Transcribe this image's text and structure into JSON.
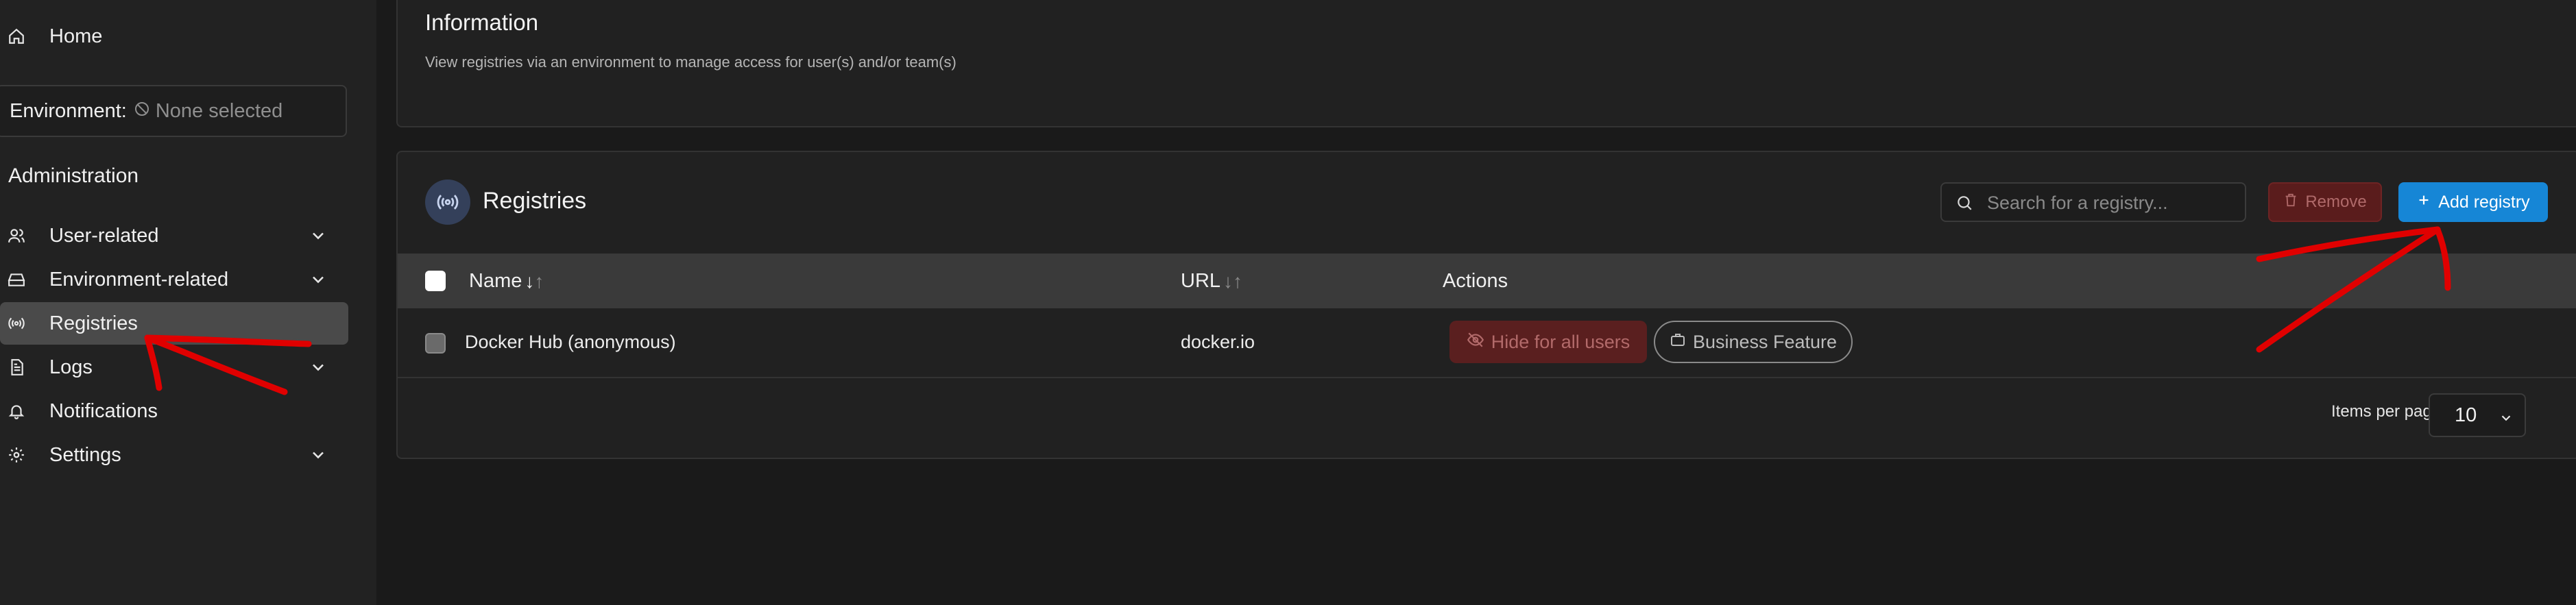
{
  "sidebar": {
    "home_label": "Home",
    "environment_label": "Environment:",
    "environment_value": "None selected",
    "admin_heading": "Administration",
    "items": [
      {
        "label": "User-related"
      },
      {
        "label": "Environment-related"
      },
      {
        "label": "Registries"
      },
      {
        "label": "Logs"
      },
      {
        "label": "Notifications"
      },
      {
        "label": "Settings"
      }
    ]
  },
  "info": {
    "title": "Information",
    "text": "View registries via an environment to manage access for user(s) and/or team(s)"
  },
  "registries": {
    "title": "Registries",
    "search_placeholder": "Search for a registry...",
    "remove_label": "Remove",
    "add_label": "Add registry",
    "columns": {
      "name": "Name",
      "url": "URL",
      "actions": "Actions"
    },
    "rows": [
      {
        "name": "Docker Hub (anonymous)",
        "url": "docker.io",
        "hide_label": "Hide for all users",
        "business_label": "Business Feature"
      }
    ],
    "items_per_page_label": "Items per page",
    "items_per_page_value": "10"
  },
  "colors": {
    "accent": "#1686d6",
    "danger": "#5a1c1c",
    "annotation": "#e00000"
  }
}
